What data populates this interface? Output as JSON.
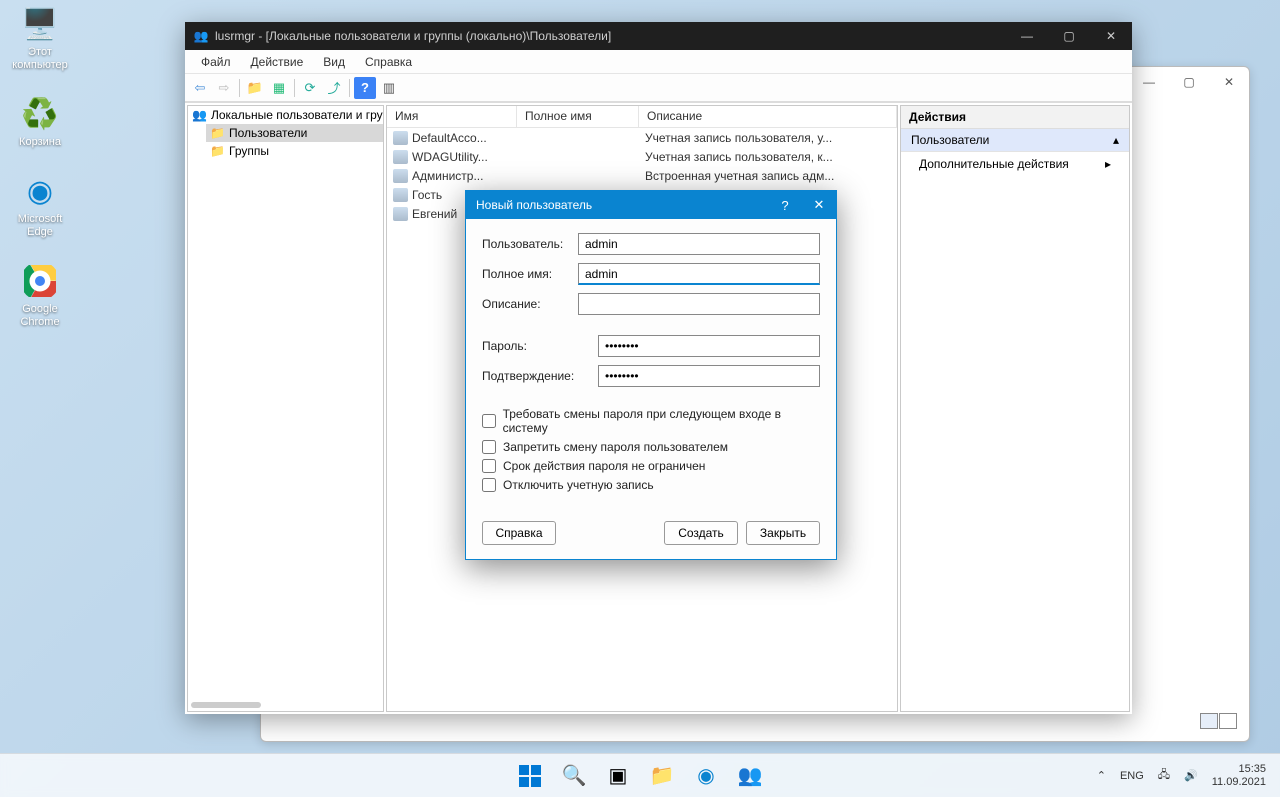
{
  "desktop": {
    "icons": [
      {
        "name": "pc-icon",
        "glyph": "🖥️",
        "label": "Этот\nкомпьютер"
      },
      {
        "name": "recycle-icon",
        "glyph": "♻️",
        "label": "Корзина"
      },
      {
        "name": "edge-icon",
        "glyph": "🌐",
        "label": "Microsoft\nEdge"
      },
      {
        "name": "chrome-icon",
        "glyph": "⭕",
        "label": "Google\nChrome"
      }
    ]
  },
  "bgWindow": {
    "min": "—",
    "max": "▢",
    "close": "✕"
  },
  "mainWindow": {
    "title": "lusrmgr - [Локальные пользователи и группы (локально)\\Пользователи]",
    "menu": [
      "Файл",
      "Действие",
      "Вид",
      "Справка"
    ],
    "tree": {
      "root": "Локальные пользователи и гру",
      "children": [
        {
          "label": "Пользователи",
          "sel": true
        },
        {
          "label": "Группы",
          "sel": false
        }
      ]
    },
    "list": {
      "headers": [
        "Имя",
        "Полное имя",
        "Описание"
      ],
      "rows": [
        {
          "name": "DefaultAcco...",
          "full": "",
          "desc": "Учетная запись пользователя, у..."
        },
        {
          "name": "WDAGUtility...",
          "full": "",
          "desc": "Учетная запись пользователя, к..."
        },
        {
          "name": "Администр...",
          "full": "",
          "desc": "Встроенная учетная запись адм..."
        },
        {
          "name": "Гость",
          "full": "",
          "desc": ""
        },
        {
          "name": "Евгений",
          "full": "",
          "desc": ""
        }
      ]
    },
    "actions": {
      "header": "Действия",
      "sub": "Пользователи",
      "item": "Дополнительные действия"
    }
  },
  "dialog": {
    "title": "Новый пользователь",
    "labels": {
      "user": "Пользователь:",
      "full": "Полное имя:",
      "desc": "Описание:",
      "pass": "Пароль:",
      "confirm": "Подтверждение:"
    },
    "values": {
      "user": "admin",
      "full": "admin",
      "desc": "",
      "pass": "••••••••",
      "confirm": "••••••••"
    },
    "checks": [
      "Требовать смены пароля при следующем входе в систему",
      "Запретить смену пароля пользователем",
      "Срок действия пароля не ограничен",
      "Отключить учетную запись"
    ],
    "buttons": {
      "help": "Справка",
      "create": "Создать",
      "close": "Закрыть"
    }
  },
  "taskbar": {
    "lang": "ENG",
    "time": "15:35",
    "date": "11.09.2021"
  }
}
